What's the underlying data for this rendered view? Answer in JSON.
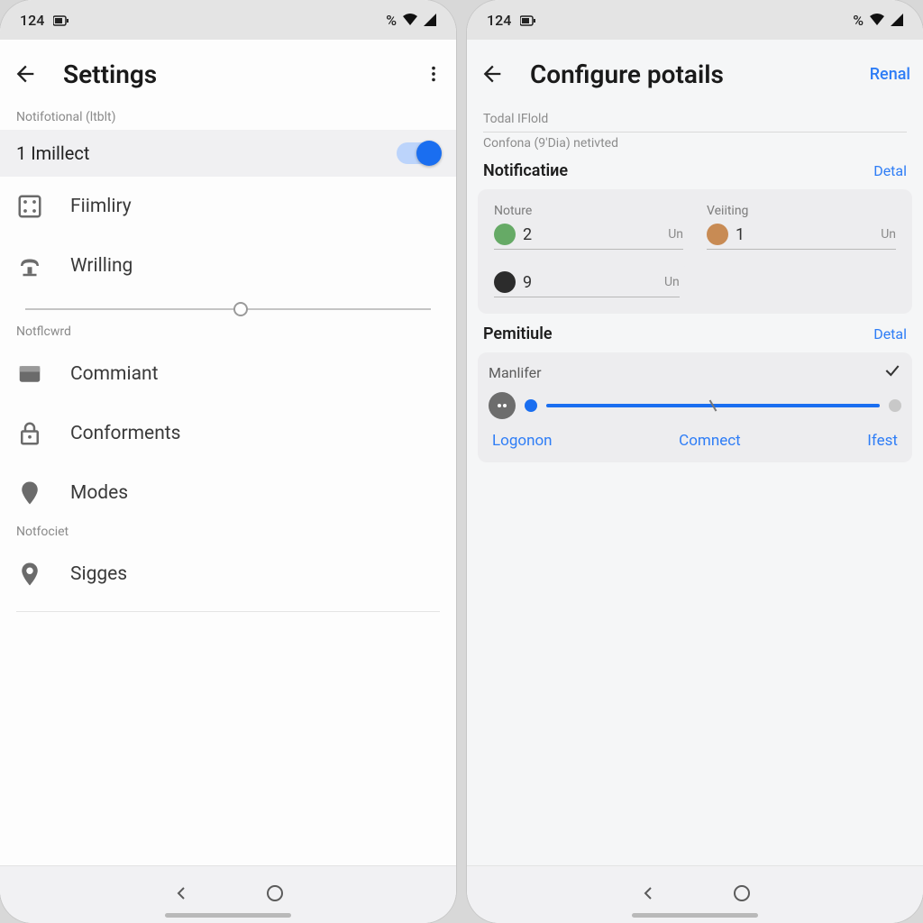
{
  "status": {
    "time": "124",
    "percent_glyph": "%"
  },
  "left": {
    "title": "Settings",
    "section1_caption": "Notifotional (ltblt)",
    "toggleRow": {
      "label": "1 Imillect",
      "on": true
    },
    "items_a": [
      {
        "label": "Fiimliry"
      },
      {
        "label": "Wrilling"
      }
    ],
    "section2_caption": "Notflcwrd",
    "items_b": [
      {
        "label": "Commiant"
      },
      {
        "label": "Conforments"
      },
      {
        "label": "Modes"
      }
    ],
    "section3_caption": "Notfociet",
    "items_c": [
      {
        "label": "Sigges"
      }
    ]
  },
  "right": {
    "title": "Configure potails",
    "action": "Renal",
    "line1": "Todal IFlold",
    "line2": "Confona (9'Dia) netivted",
    "notif_head": "Notificatiие",
    "detal": "Detal",
    "stats": [
      {
        "label": "Noture",
        "value": "2",
        "unit": "Un"
      },
      {
        "label": "Veiiting",
        "value": "1",
        "unit": "Un"
      },
      {
        "label": "",
        "value": "9",
        "unit": "Un"
      }
    ],
    "perm_head": "Pemitiule",
    "perm_row": "Manlifer",
    "links": {
      "a": "Logonon",
      "b": "Comnect",
      "c": "Ifest"
    }
  }
}
